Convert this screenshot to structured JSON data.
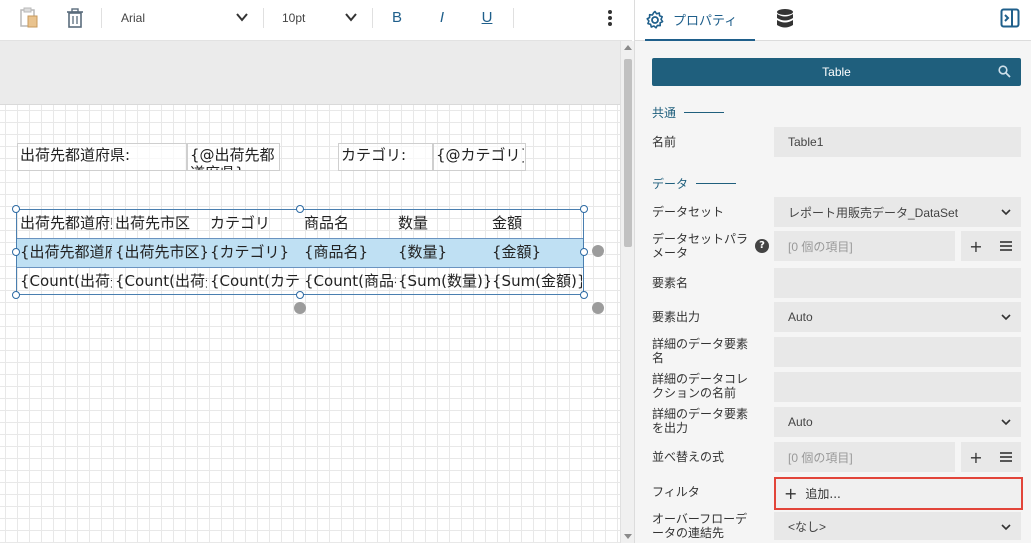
{
  "toolbar": {
    "font_family": "Arial",
    "font_size": "10pt",
    "bold": "B",
    "italic": "I",
    "underline": "U"
  },
  "report": {
    "header_fields": [
      {
        "text": "出荷先都道府県:"
      },
      {
        "text": "{@出荷先都道府県}"
      },
      {
        "text": "カテゴリ:"
      },
      {
        "text": "{@カテゴリ}"
      }
    ],
    "table": {
      "header_row": [
        "出荷先都道府県",
        "出荷先市区",
        "カテゴリ",
        "商品名",
        "数量",
        "金額"
      ],
      "detail_row": [
        "{出荷先都道府県}",
        "{出荷先市区}",
        "{カテゴリ}",
        "{商品名}",
        "{数量}",
        "{金額}"
      ],
      "footer_row": [
        "{Count(出荷先都道府県)}",
        "{Count(出荷先市区)}",
        "{Count(カテゴリ)}",
        "{Count(商品名)}",
        "{Sum(数量)}",
        "{Sum(金額)}"
      ]
    }
  },
  "panel": {
    "tab_properties": "プロパティ",
    "selected_item": "Table",
    "sections": {
      "common": "共通",
      "data": "データ"
    },
    "props": {
      "name_label": "名前",
      "name_value": "Table1",
      "dataset_label": "データセット",
      "dataset_value": "レポート用販売データ_DataSet",
      "dataset_params_label": "データセットパラメータ",
      "dataset_params_value": "[0 個の項目]",
      "element_name_label": "要素名",
      "element_output_label": "要素出力",
      "element_output_value": "Auto",
      "detail_element_name_label": "詳細のデータ要素名",
      "detail_collection_label": "詳細のデータコレクションの名前",
      "detail_element_output_label": "詳細のデータ要素を出力",
      "detail_element_output_value": "Auto",
      "sort_label": "並べ替えの式",
      "sort_value": "[0 個の項目]",
      "filter_label": "フィルタ",
      "filter_add": "追加...",
      "overflow_label": "オーバーフローデータの連結先",
      "overflow_value": "<なし>"
    }
  }
}
